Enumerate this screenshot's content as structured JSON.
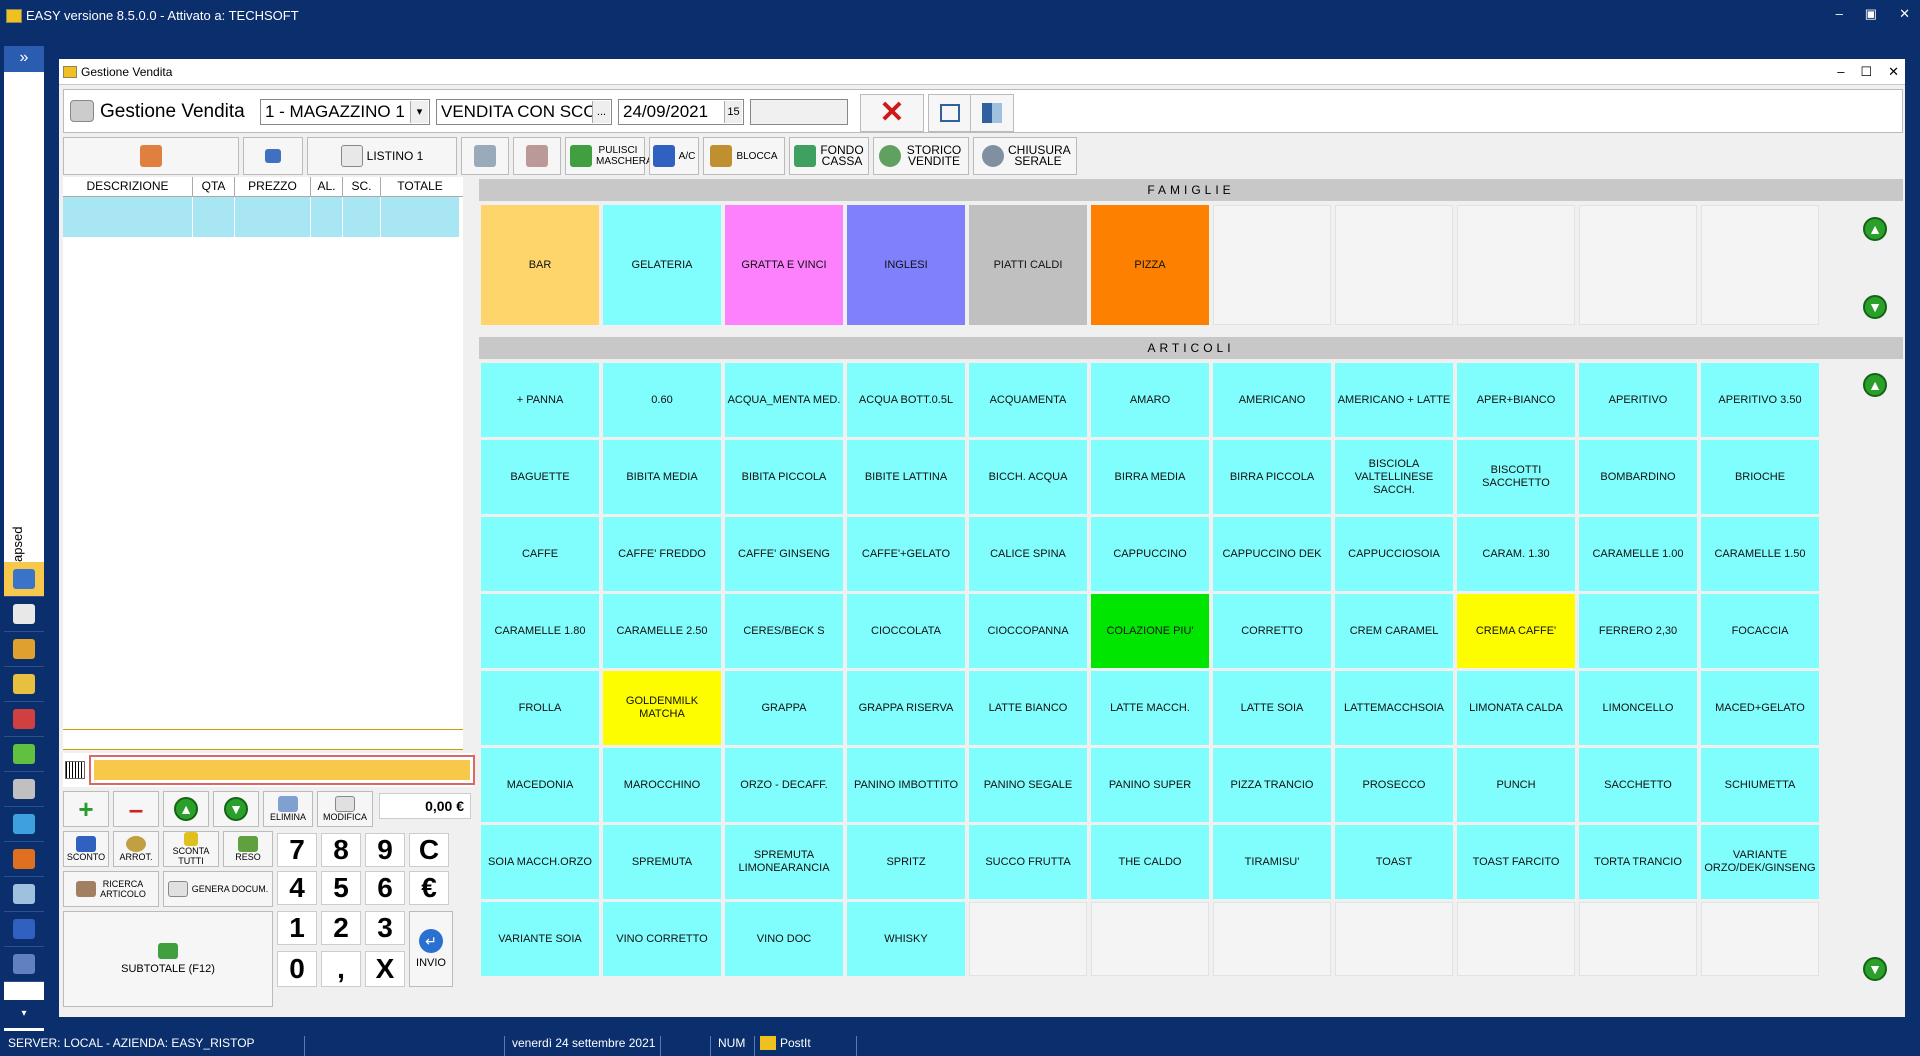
{
  "app": {
    "title": "EASY versione 8.5.0.0 - Attivato a: TECHSOFT",
    "min": "–",
    "restore": "▣",
    "close": "✕"
  },
  "rail": {
    "expand_icon": "»",
    "collapsed_label": "apsed",
    "bottom_icon": "▾"
  },
  "window": {
    "title": "Gestione Vendita",
    "min": "–",
    "max": "☐",
    "close": "✕"
  },
  "header": {
    "title": "Gestione Vendita",
    "magazzino": "1 - MAGAZZINO 1",
    "magazzino_btn": "▾",
    "vendita": "VENDITA CON SCO",
    "vendita_btn": "...",
    "date": "24/09/2021",
    "date_btn": "15",
    "extra_field": ""
  },
  "toolbar": {
    "listino": "LISTINO 1",
    "pulisci": "PULISCI MASCHERA",
    "ac": "A/C",
    "blocca": "BLOCCA",
    "fondo": "FONDO CASSA",
    "storico": "STORICO VENDITE",
    "chiusura": "CHIUSURA SERALE"
  },
  "receipt": {
    "columns": [
      "DESCRIZIONE",
      "QTA",
      "PREZZO",
      "AL.",
      "SC.",
      "TOTALE"
    ]
  },
  "keypad": {
    "elimina": "ELIMINA",
    "modifica": "MODIFICA",
    "total": "0,00 €",
    "sconto": "SCONTO",
    "arrot": "ARROT.",
    "sconta_tutti": "SCONTA TUTTI",
    "reso": "RESO",
    "ricerca": "RICERCA ARTICOLO",
    "genera": "GENERA DOCUM.",
    "subtotale": "SUBTOTALE (F12)",
    "invio": "INVIO",
    "digits": [
      "7",
      "8",
      "9",
      "C",
      "4",
      "5",
      "6",
      "€",
      "1",
      "2",
      "3",
      "0",
      ",",
      "X"
    ]
  },
  "famiglie": {
    "title": "FAMIGLIE",
    "items": [
      {
        "label": "BAR",
        "color": "#fdd56b"
      },
      {
        "label": "GELATERIA",
        "color": "#80fdfd"
      },
      {
        "label": "GRATTA E VINCI",
        "color": "#fd80fd"
      },
      {
        "label": "INGLESI",
        "color": "#8080fd"
      },
      {
        "label": "PIATTI CALDI",
        "color": "#c0c0c0"
      },
      {
        "label": "PIZZA",
        "color": "#fd8000"
      }
    ]
  },
  "articoli": {
    "title": "ARTICOLI",
    "items": [
      "+ PANNA",
      "0.60",
      "ACQUA_MENTA MED.",
      "ACQUA BOTT.0.5L",
      "ACQUAMENTA",
      "AMARO",
      "AMERICANO",
      "AMERICANO + LATTE",
      "APER+BIANCO",
      "APERITIVO",
      "APERITIVO 3.50",
      "BAGUETTE",
      "BIBITA MEDIA",
      "BIBITA PICCOLA",
      "BIBITE LATTINA",
      "BICCH. ACQUA",
      "BIRRA MEDIA",
      "BIRRA PICCOLA",
      "BISCIOLA VALTELLINESE SACCH.",
      "BISCOTTI SACCHETTO",
      "BOMBARDINO",
      "BRIOCHE",
      "CAFFE",
      "CAFFE' FREDDO",
      "CAFFE' GINSENG",
      "CAFFE'+GELATO",
      "CALICE SPINA",
      "CAPPUCCINO",
      "CAPPUCCINO DEK",
      "CAPPUCCIOSOIA",
      "CARAM. 1.30",
      "CARAMELLE 1.00",
      "CARAMELLE 1.50",
      "CARAMELLE 1.80",
      "CARAMELLE 2.50",
      "CERES/BECK S",
      "CIOCCOLATA",
      "CIOCCOPANNA",
      "COLAZIONE PIU'",
      "CORRETTO",
      "CREM CARAMEL",
      "CREMA CAFFE'",
      "FERRERO 2,30",
      "FOCACCIA",
      "FROLLA",
      "GOLDENMILK MATCHA",
      "GRAPPA",
      "GRAPPA RISERVA",
      "LATTE BIANCO",
      "LATTE MACCH.",
      "LATTE SOIA",
      "LATTEMACCHSOIA",
      "LIMONATA CALDA",
      "LIMONCELLO",
      "MACED+GELATO",
      "MACEDONIA",
      "MAROCCHINO",
      "ORZO - DECAFF.",
      "PANINO IMBOTTITO",
      "PANINO SEGALE",
      "PANINO SUPER",
      "PIZZA TRANCIO",
      "PROSECCO",
      "PUNCH",
      "SACCHETTO",
      "SCHIUMETTA",
      "SOIA MACCH.ORZO",
      "SPREMUTA",
      "SPREMUTA LIMONEARANCIA",
      "SPRITZ",
      "SUCCO FRUTTA",
      "THE  CALDO",
      "TIRAMISU'",
      "TOAST",
      "TOAST FARCITO",
      "TORTA TRANCIO",
      "VARIANTE ORZO/DEK/GINSENG",
      "VARIANTE SOIA",
      "VINO CORRETTO",
      "VINO DOC",
      "WHISKY"
    ],
    "colors": {
      "default": "#80fdfd",
      "COLAZIONE PIU'": "#00e600",
      "CREMA CAFFE'": "#fdfd00",
      "GOLDENMILK MATCHA": "#fdfd00"
    }
  },
  "arrows": {
    "up": "▲",
    "down": "▼"
  },
  "status": {
    "server": "SERVER: LOCAL - AZIENDA: EASY_RISTOP",
    "date": "venerdì 24 settembre 2021",
    "num": "NUM",
    "postit": "PostIt"
  }
}
